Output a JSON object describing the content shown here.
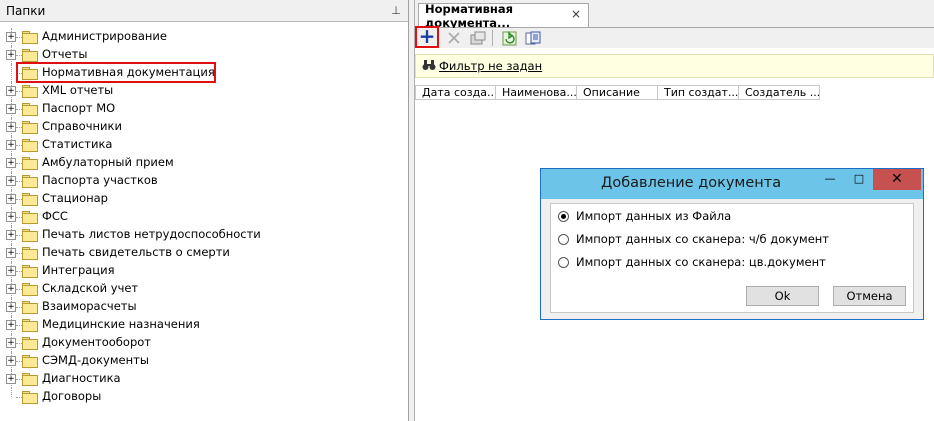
{
  "left_panel": {
    "title": "Папки",
    "tree": [
      {
        "label": "Администрирование",
        "expandable": true
      },
      {
        "label": "Отчеты",
        "expandable": true
      },
      {
        "label": "Нормативная документация",
        "expandable": false,
        "selected": true
      },
      {
        "label": "XML отчеты",
        "expandable": true
      },
      {
        "label": "Паспорт МО",
        "expandable": true
      },
      {
        "label": "Справочники",
        "expandable": true
      },
      {
        "label": "Статистика",
        "expandable": true
      },
      {
        "label": "Амбулаторный прием",
        "expandable": true
      },
      {
        "label": "Паспорта участков",
        "expandable": true
      },
      {
        "label": "Стационар",
        "expandable": true
      },
      {
        "label": "ФСС",
        "expandable": true
      },
      {
        "label": "Печать листов нетрудоспособности",
        "expandable": true
      },
      {
        "label": "Печать свидетельств о смерти",
        "expandable": true
      },
      {
        "label": "Интеграция",
        "expandable": true
      },
      {
        "label": "Складской учет",
        "expandable": true
      },
      {
        "label": "Взаиморасчеты",
        "expandable": true
      },
      {
        "label": "Медицинские назначения",
        "expandable": true
      },
      {
        "label": "Документооборот",
        "expandable": true
      },
      {
        "label": "СЭМД-документы",
        "expandable": true
      },
      {
        "label": "Диагностика",
        "expandable": true
      },
      {
        "label": "Договоры",
        "expandable": false
      }
    ]
  },
  "right_panel": {
    "tab_label": "Нормативная документа...",
    "tab_close": "×",
    "toolbar": {
      "add": "+",
      "icons": [
        "delete-icon",
        "properties-icon",
        "refresh-icon",
        "export-icon"
      ]
    },
    "filter_text": "Фильтр не задан",
    "columns": [
      "Дата созда...",
      "Наименова...",
      "Описание",
      "Тип создат...",
      "Создатель ..."
    ]
  },
  "dialog": {
    "title": "Добавление документа",
    "minimize": "—",
    "maximize": "□",
    "close": "✕",
    "options": [
      {
        "label": "Импорт данных из Файла",
        "checked": true
      },
      {
        "label": "Импорт данных со сканера: ч/б документ",
        "checked": false
      },
      {
        "label": "Импорт данных со сканера: цв.документ",
        "checked": false
      }
    ],
    "ok_label": "Ok",
    "cancel_label": "Отмена"
  },
  "colors": {
    "highlight": "#e01010",
    "dialog_title_bg": "#6cc4e8",
    "filter_bg": "#ffffe1",
    "close_btn": "#c75050"
  }
}
